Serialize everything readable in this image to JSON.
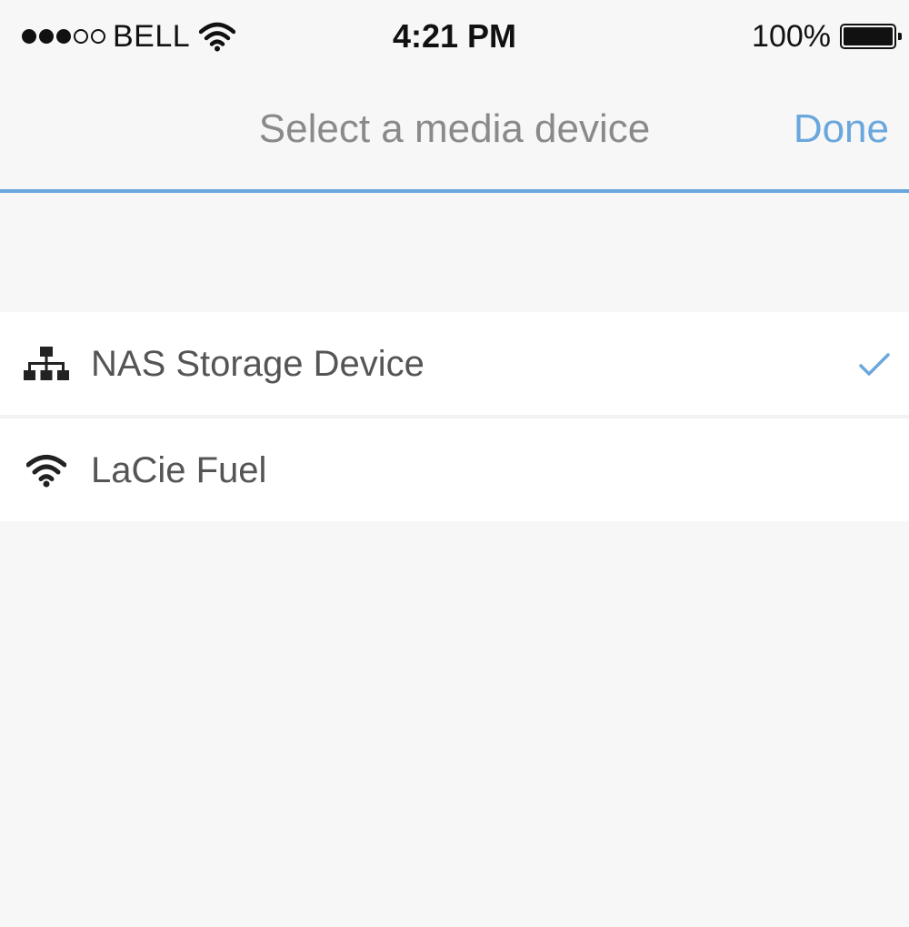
{
  "status_bar": {
    "carrier": "BELL",
    "signal_bars_filled": 3,
    "signal_bars_total": 5,
    "time": "4:21 PM",
    "battery_percent": "100%",
    "battery_level": 1.0
  },
  "nav": {
    "title": "Select a media device",
    "done_label": "Done"
  },
  "devices": [
    {
      "label": "NAS Storage Device",
      "icon": "network-icon",
      "selected": true
    },
    {
      "label": "LaCie Fuel",
      "icon": "wifi-icon",
      "selected": false
    }
  ],
  "colors": {
    "accent": "#6aa7dd",
    "background": "#f7f7f7",
    "row_background": "#ffffff",
    "title_text": "#8a8a8a",
    "row_text": "#555555"
  }
}
